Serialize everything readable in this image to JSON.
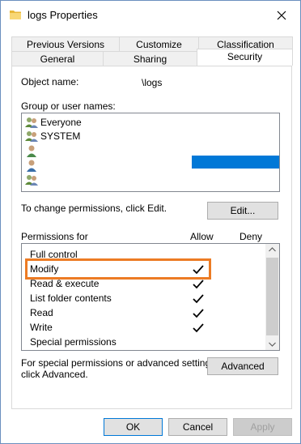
{
  "window": {
    "title": "logs Properties",
    "close_glyph": "✕"
  },
  "tabs_row1": [
    {
      "label": "Previous Versions"
    },
    {
      "label": "Customize"
    },
    {
      "label": "Classification"
    }
  ],
  "tabs_row2": [
    {
      "label": "General"
    },
    {
      "label": "Sharing"
    },
    {
      "label": "Security",
      "active": true
    }
  ],
  "security": {
    "object_name_label": "Object name:",
    "object_name_value": "\\logs",
    "group_label": "Group or user names:",
    "users": [
      {
        "name": "Everyone",
        "icon": "users-group-icon"
      },
      {
        "name": "SYSTEM",
        "icon": "users-group-icon"
      },
      {
        "name": "",
        "icon": "user-icon"
      },
      {
        "name": "",
        "icon": "user-icon"
      },
      {
        "name": "",
        "icon": "users-group-icon"
      }
    ],
    "change_text": "To change permissions, click Edit.",
    "edit_button": "Edit...",
    "permissions_for_label": "Permissions for",
    "allow_header": "Allow",
    "deny_header": "Deny",
    "permissions": [
      {
        "name": "Full control",
        "allow": false,
        "deny": false
      },
      {
        "name": "Modify",
        "allow": true,
        "deny": false,
        "highlighted": true
      },
      {
        "name": "Read & execute",
        "allow": true,
        "deny": false
      },
      {
        "name": "List folder contents",
        "allow": true,
        "deny": false
      },
      {
        "name": "Read",
        "allow": true,
        "deny": false
      },
      {
        "name": "Write",
        "allow": true,
        "deny": false
      },
      {
        "name": "Special permissions",
        "allow": false,
        "deny": false
      }
    ],
    "advanced_text_line1": "For special permissions or advanced settings,",
    "advanced_text_line2": "click Advanced.",
    "advanced_button": "Advanced"
  },
  "footer": {
    "ok_button": "OK",
    "cancel_button": "Cancel",
    "apply_button": "Apply"
  },
  "colors": {
    "accent": "#0078d7",
    "highlight": "#ec7b24",
    "selection": "#0078d7"
  }
}
